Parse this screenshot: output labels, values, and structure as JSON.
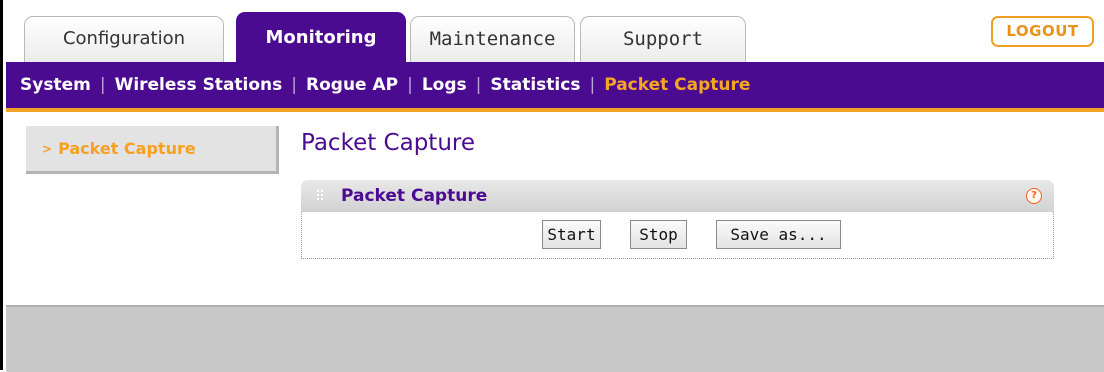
{
  "tabs": [
    {
      "label": "Configuration",
      "active": false
    },
    {
      "label": "Monitoring",
      "active": true
    },
    {
      "label": "Maintenance",
      "active": false
    },
    {
      "label": "Support",
      "active": false
    }
  ],
  "logout_label": "LOGOUT",
  "subnav": [
    {
      "label": "System",
      "active": false
    },
    {
      "label": "Wireless Stations",
      "active": false
    },
    {
      "label": "Rogue AP",
      "active": false
    },
    {
      "label": "Logs",
      "active": false
    },
    {
      "label": "Statistics",
      "active": false
    },
    {
      "label": "Packet Capture",
      "active": true
    }
  ],
  "sidebar": {
    "items": [
      {
        "label": "Packet Capture",
        "active": true
      }
    ]
  },
  "page_title": "Packet Capture",
  "panel": {
    "title": "Packet Capture",
    "help_icon": "?",
    "buttons": {
      "start": "Start",
      "stop": "Stop",
      "save_as": "Save as..."
    }
  },
  "colors": {
    "brand_purple": "#4b0b91",
    "accent_orange": "#f5a623"
  }
}
